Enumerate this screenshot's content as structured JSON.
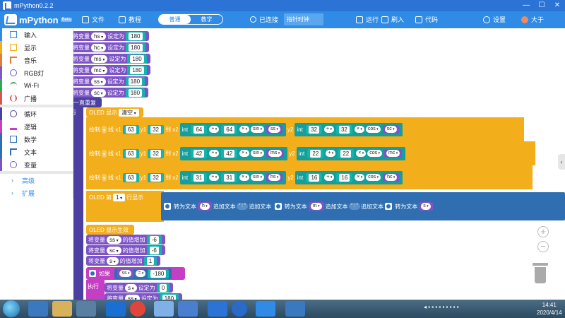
{
  "window": {
    "title": "mPython0.2.2",
    "minimize": "—",
    "maximize": "☐",
    "close": "✕"
  },
  "toolbar": {
    "app_name": "mPython",
    "version_badge": "Beta",
    "file": "文件",
    "tutorial": "教程",
    "mode_normal": "普通",
    "mode_teach": "教学",
    "connection_status": "已连接",
    "device_select": "指针时钟",
    "run": "运行",
    "flash": "刷入",
    "code": "代码",
    "settings": "设置",
    "user": "大于"
  },
  "sidebar": {
    "items": [
      {
        "label": "输入",
        "color": "#2f8be6"
      },
      {
        "label": "显示",
        "color": "#f3ae1b"
      },
      {
        "label": "音乐",
        "color": "#e07b3a"
      },
      {
        "label": "RGB灯",
        "color": "#7e57c2"
      },
      {
        "label": "Wi-Fi",
        "color": "#35a853"
      },
      {
        "label": "广播",
        "color": "#d9534f"
      },
      {
        "label": "循环",
        "color": "#4b3fa0"
      },
      {
        "label": "逻辑",
        "color": "#c33fc3"
      },
      {
        "label": "数学",
        "color": "#2f6fb1"
      },
      {
        "label": "文本",
        "color": "#2f6fb1"
      },
      {
        "label": "变量",
        "color": "#7d54c5"
      }
    ],
    "advanced": "高级",
    "extensions": "扩展"
  },
  "workspace": {
    "set_var": "将变量",
    "set_to": "设定为",
    "forever": "一直重复",
    "exec_partial": "行",
    "oled_display": "OLED 显示",
    "clear": "清空",
    "draw": "绘制",
    "line": "线",
    "x1": "x1",
    "y1": "y1",
    "to": "到",
    "x2": "x2",
    "y2": "y2",
    "int": "int",
    "plus": "+",
    "times": "×",
    "sin": "sin",
    "cos": "cos",
    "oled_row": "OLED 第",
    "row_display": "行显示",
    "to_text": "转为文本",
    "append_text": "追加文本",
    "colon": "“ : ”",
    "oled_apply": "OLED 显示生效",
    "increment_of": "的值增加",
    "if": "如果",
    "do": "执行",
    "eq": "=",
    "init_vars": [
      {
        "name": "hs",
        "value": "180"
      },
      {
        "name": "hc",
        "value": "180"
      },
      {
        "name": "ms",
        "value": "180"
      },
      {
        "name": "mc",
        "value": "180"
      },
      {
        "name": "ss",
        "value": "180"
      },
      {
        "name": "sc",
        "value": "180"
      }
    ],
    "lines": [
      {
        "x1": "63",
        "y1": "32",
        "x_add": "64",
        "x_mul": "64",
        "x_var": "ss",
        "y_add": "32",
        "y_mul": "32",
        "y_var": "sc"
      },
      {
        "x1": "63",
        "y1": "32",
        "x_add": "42",
        "x_mul": "42",
        "x_var": "ms",
        "y_add": "22",
        "y_mul": "22",
        "y_var": "mc"
      },
      {
        "x1": "63",
        "y1": "32",
        "x_add": "31",
        "x_mul": "31",
        "x_var": "hs",
        "y_add": "16",
        "y_mul": "16",
        "y_var": "hc"
      }
    ],
    "row_num": "1",
    "row_var1": "h",
    "row_var2": "m",
    "row_var3": "s",
    "increments": [
      {
        "var": "ss",
        "value": "-6"
      },
      {
        "var": "sc",
        "value": "-6"
      },
      {
        "var": "s",
        "value": "1"
      }
    ],
    "if_var": "ss",
    "if_value": "-180",
    "then_sets": [
      {
        "var": "s",
        "value": "0"
      },
      {
        "var": "ss",
        "value": "180"
      }
    ]
  },
  "zoom": {
    "in": "+",
    "out": "−"
  },
  "taskbar": {
    "time": "14:41",
    "date": "2020/4/14"
  }
}
